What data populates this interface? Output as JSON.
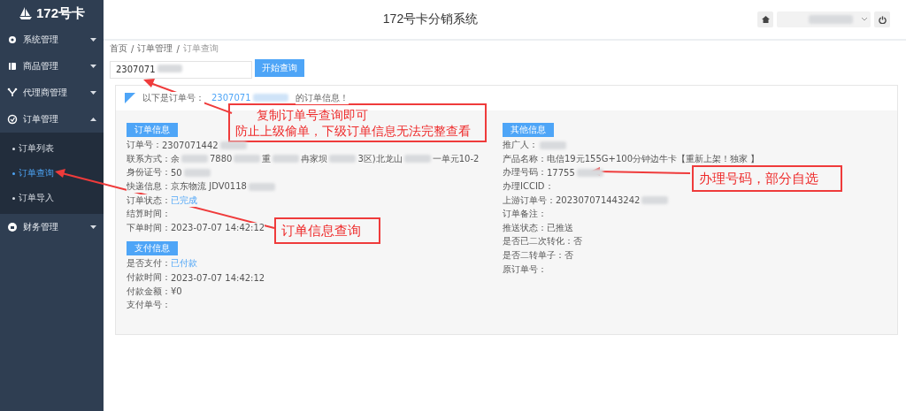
{
  "sidebar": {
    "logo": "172号卡",
    "items": [
      {
        "label": "系统管理",
        "kind": "gear",
        "expanded": false
      },
      {
        "label": "商品管理",
        "kind": "book",
        "expanded": false
      },
      {
        "label": "代理商管理",
        "kind": "network",
        "expanded": false
      },
      {
        "label": "订单管理",
        "kind": "orders",
        "expanded": true,
        "children": [
          {
            "label": "订单列表",
            "selected": false
          },
          {
            "label": "订单查询",
            "selected": true
          },
          {
            "label": "订单导入",
            "selected": false
          }
        ]
      },
      {
        "label": "财务管理",
        "kind": "finance",
        "expanded": false
      }
    ]
  },
  "header": {
    "title": "172号卡分销系统"
  },
  "breadcrumb": [
    {
      "label": "首页"
    },
    {
      "separator": "/",
      "label": "订单管理"
    },
    {
      "separator": "/",
      "label": "订单查询"
    }
  ],
  "search": {
    "value": "2307071",
    "redacted": true,
    "button": "开始查询"
  },
  "result": {
    "prefix": "以下是订单号：",
    "order_link": "2307071",
    "suffix": "的订单信息！",
    "left_sections": [
      {
        "title": "订单信息",
        "fields": [
          {
            "label": "订单号：",
            "parts": [
              "2307071442"
            ],
            "blur_after": true,
            "kind": "text"
          },
          {
            "label": "联系方式：",
            "parts": [
              "余",
              "7880",
              "重",
              "冉家坝",
              "3区)北龙山",
              "一单元10-2"
            ],
            "blur_after": false,
            "kind": "text"
          },
          {
            "label": "身份证号：",
            "parts": [
              "50"
            ],
            "blur_after": true,
            "kind": "text"
          },
          {
            "label": "快递信息：",
            "parts": [
              "京东物流  JDV0118"
            ],
            "blur_after": true,
            "kind": "text"
          },
          {
            "label": "订单状态：",
            "parts": [
              "已完成"
            ],
            "blur_after": false,
            "kind": "link"
          },
          {
            "label": "结算时间：",
            "blur_after": false
          },
          {
            "label": "下单时间：",
            "parts": [
              "2023-07-07 14:42:12"
            ],
            "blur_after": false,
            "kind": "text"
          }
        ]
      },
      {
        "title": "支付信息",
        "fields": [
          {
            "label": "是否支付：",
            "parts": [
              "已付款"
            ],
            "blur_after": false,
            "kind": "link"
          },
          {
            "label": "付款时间：",
            "parts": [
              "2023-07-07 14:42:12"
            ],
            "blur_after": false,
            "kind": "text"
          },
          {
            "label": "付款金额：",
            "parts": [
              "¥0"
            ],
            "blur_after": false,
            "kind": "text"
          },
          {
            "label": "支付单号：",
            "blur_after": false
          }
        ]
      }
    ],
    "right_sections": [
      {
        "title": "其他信息",
        "fields": [
          {
            "label": "推广人：",
            "blur_after": true
          },
          {
            "label": "产品名称：",
            "parts": [
              "电信19元155G+100分钟边牛卡【重新上架！独家 】"
            ],
            "blur_after": false,
            "kind": "text"
          },
          {
            "label": "办理号码：",
            "parts": [
              "17755"
            ],
            "blur_after": true,
            "kind": "text"
          },
          {
            "label": "办理ICCID：",
            "blur_after": false
          },
          {
            "label": "上游订单号：",
            "parts": [
              "202307071443242"
            ],
            "blur_after": true,
            "kind": "text"
          },
          {
            "label": "订单备注：",
            "blur_after": false
          },
          {
            "label": "推送状态：",
            "parts": [
              "已推送"
            ],
            "blur_after": false,
            "kind": "text"
          },
          {
            "label": "是否已二次转化：",
            "parts": [
              "否"
            ],
            "blur_after": false,
            "kind": "text"
          },
          {
            "label": "是否二转单子：",
            "parts": [
              "否"
            ],
            "blur_after": false,
            "kind": "text"
          },
          {
            "label": "原订单号：",
            "blur_after": false
          }
        ]
      }
    ]
  },
  "annotations": [
    {
      "lines": [
        "复制订单号查询即可",
        "防止上级偷单，下级订单信息无法完整查看"
      ],
      "kind": "copy"
    },
    {
      "lines": [
        "订单信息查询"
      ],
      "kind": "menu"
    },
    {
      "lines": [
        "办理号码，部分自选"
      ],
      "kind": "number"
    }
  ]
}
